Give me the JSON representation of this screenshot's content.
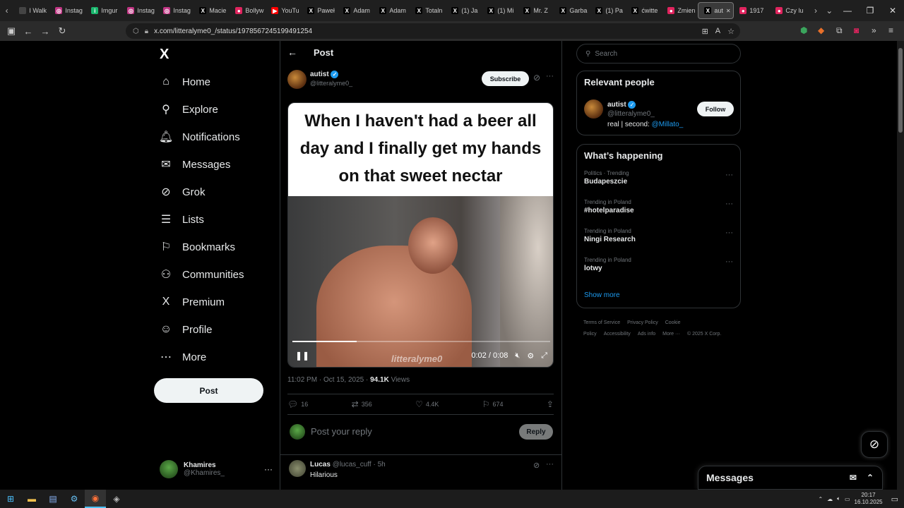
{
  "browser": {
    "tabs": [
      {
        "label": "I Walk",
        "color": "#444",
        "glyph": ""
      },
      {
        "label": "Instag",
        "color": "#c13584",
        "glyph": "◎"
      },
      {
        "label": "Imgur",
        "color": "#1bb76e",
        "glyph": "i"
      },
      {
        "label": "Instag",
        "color": "#c13584",
        "glyph": "◎"
      },
      {
        "label": "Instag",
        "color": "#c13584",
        "glyph": "◎"
      },
      {
        "label": "Macie",
        "color": "#000",
        "glyph": "X"
      },
      {
        "label": "Bollyw",
        "color": "#e0245e",
        "glyph": "●"
      },
      {
        "label": "YouTu",
        "color": "#ff0000",
        "glyph": "▶"
      },
      {
        "label": "Paweł",
        "color": "#000",
        "glyph": "X"
      },
      {
        "label": "Adam",
        "color": "#000",
        "glyph": "X"
      },
      {
        "label": "Adam",
        "color": "#000",
        "glyph": "X"
      },
      {
        "label": "Totaln",
        "color": "#000",
        "glyph": "X"
      },
      {
        "label": "(1) Ja",
        "color": "#000",
        "glyph": "X"
      },
      {
        "label": "(1) Mi",
        "color": "#000",
        "glyph": "X"
      },
      {
        "label": "Mr. Z",
        "color": "#000",
        "glyph": "X"
      },
      {
        "label": "Garba",
        "color": "#000",
        "glyph": "X"
      },
      {
        "label": "(1) Pa",
        "color": "#000",
        "glyph": "X"
      },
      {
        "label": "ćwittе",
        "color": "#000",
        "glyph": "X"
      },
      {
        "label": "Zmien",
        "color": "#e0245e",
        "glyph": "●"
      },
      {
        "label": "aut",
        "color": "#000",
        "glyph": "X",
        "active": true
      },
      {
        "label": "1917",
        "color": "#e0245e",
        "glyph": "●"
      },
      {
        "label": "Czy lu",
        "color": "#e0245e",
        "glyph": "●"
      }
    ],
    "url": "x.com/litteralyme0_/status/1978567245199491254"
  },
  "nav": {
    "logo": "X",
    "items": [
      {
        "label": "Home",
        "icon": "home-icon",
        "glyph": "⌂"
      },
      {
        "label": "Explore",
        "icon": "search-icon",
        "glyph": "⚲"
      },
      {
        "label": "Notifications",
        "icon": "bell-icon",
        "glyph": "🔔︎"
      },
      {
        "label": "Messages",
        "icon": "mail-icon",
        "glyph": "✉"
      },
      {
        "label": "Grok",
        "icon": "grok-icon",
        "glyph": "⊘"
      },
      {
        "label": "Lists",
        "icon": "list-icon",
        "glyph": "☰"
      },
      {
        "label": "Bookmarks",
        "icon": "bookmark-icon",
        "glyph": "⚐"
      },
      {
        "label": "Communities",
        "icon": "communities-icon",
        "glyph": "⚇"
      },
      {
        "label": "Premium",
        "icon": "premium-icon",
        "glyph": "X"
      },
      {
        "label": "Profile",
        "icon": "profile-icon",
        "glyph": "☺"
      },
      {
        "label": "More",
        "icon": "more-icon",
        "glyph": "⋯"
      }
    ],
    "post_button": "Post",
    "account": {
      "name": "Khamires",
      "handle": "@Khamires_"
    }
  },
  "post": {
    "header_title": "Post",
    "author": {
      "name": "autist",
      "handle": "@litteralyme0_"
    },
    "subscribe_label": "Subscribe",
    "caption": "When I haven't had a beer all day and I finally get my hands on that sweet nectar",
    "video": {
      "time": "0:02 / 0:08",
      "watermark": "litteralyme0",
      "progress": 0.25
    },
    "time": "11:02 PM · Oct 15, 2025 · ",
    "views_count": "94.1K",
    "views_label": " Views",
    "stats": {
      "replies": "16",
      "reposts": "356",
      "likes": "4.4K",
      "bookmarks": "674"
    },
    "reply_placeholder": "Post your reply",
    "reply_button": "Reply"
  },
  "reply": {
    "name": "Lucas",
    "handle": "@lucas_cuff · 5h",
    "text": "Hilarious"
  },
  "sidebar": {
    "search_placeholder": "Search",
    "relevant_title": "Relevant people",
    "person": {
      "name": "autist",
      "handle": "@litteralyme0_",
      "bio_prefix": "real | second: ",
      "bio_link": "@Millato_",
      "follow_label": "Follow"
    },
    "happening_title": "What’s happening",
    "trends": [
      {
        "category": "Politics · Trending",
        "name": "Budapeszcie"
      },
      {
        "category": "Trending in Poland",
        "name": "#hotelparadise"
      },
      {
        "category": "Trending in Poland",
        "name": "Ningi Research"
      },
      {
        "category": "Trending in Poland",
        "name": "lotwy"
      }
    ],
    "show_more": "Show more",
    "footer": [
      "Terms of Service",
      "Privacy Policy",
      "Cookie Policy",
      "Accessibility",
      "Ads info",
      "More ···",
      "© 2025 X Corp."
    ]
  },
  "messages_dock": {
    "title": "Messages"
  },
  "taskbar": {
    "time": "20:17",
    "date": "16.10.2025"
  },
  "colors": {
    "accent": "#1d9bf0",
    "bg": "#000000",
    "border": "#2f3336"
  }
}
